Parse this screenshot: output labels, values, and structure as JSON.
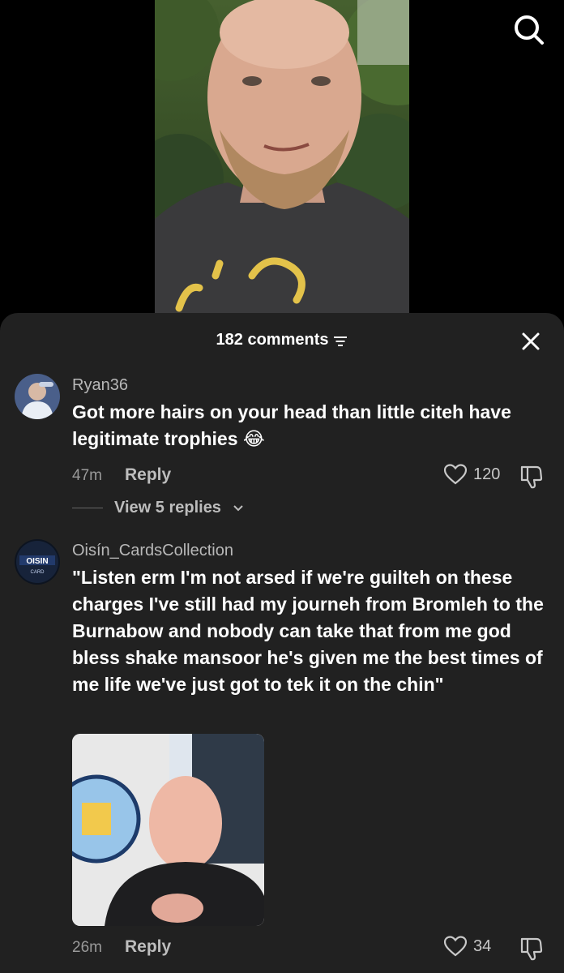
{
  "header": {
    "search_icon": "search-icon"
  },
  "sheet": {
    "comment_count": "182 comments",
    "filter_icon": "filter-icon",
    "close_icon": "close-icon"
  },
  "comments": [
    {
      "username": "Ryan36",
      "text": "Got more hairs on your head than little citeh have legitimate trophies 😂",
      "time": "47m",
      "reply_label": "Reply",
      "likes": "120",
      "view_replies": "View 5 replies"
    },
    {
      "username": "Oisín_CardsCollection",
      "text": "\"Listen erm I'm not arsed if we're guilteh on these charges I've still had my journeh from Bromleh to the Burnabow and nobody can take that from me god bless shake mansoor he's given me the best times of me life we've just got to tek it on the chin\"",
      "time": "26m",
      "reply_label": "Reply",
      "likes": "34",
      "avatar_text": "OISIN",
      "avatar_subtext": "CARD"
    }
  ],
  "colors": {
    "sheet_bg": "#212121",
    "text_primary": "#ffffff",
    "text_secondary": "#9a9a9a"
  }
}
